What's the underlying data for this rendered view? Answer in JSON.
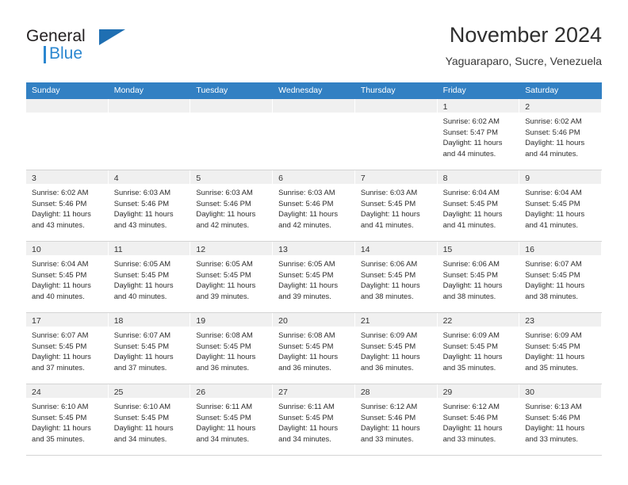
{
  "brand": {
    "name_part1": "General",
    "name_part2": "Blue",
    "triangle_color": "#1f6fb2",
    "blue_color": "#2b87d0"
  },
  "header": {
    "title": "November 2024",
    "subtitle": "Yaguaraparo, Sucre, Venezuela"
  },
  "theme": {
    "header_band": "#3280c3",
    "daynum_strip": "#f0f0f0",
    "grid_line": "#d4d4d4",
    "text": "#2c2c2c"
  },
  "weekdays": [
    "Sunday",
    "Monday",
    "Tuesday",
    "Wednesday",
    "Thursday",
    "Friday",
    "Saturday"
  ],
  "weeks": [
    [
      {
        "day": "",
        "lines": []
      },
      {
        "day": "",
        "lines": []
      },
      {
        "day": "",
        "lines": []
      },
      {
        "day": "",
        "lines": []
      },
      {
        "day": "",
        "lines": []
      },
      {
        "day": "1",
        "lines": [
          "Sunrise: 6:02 AM",
          "Sunset: 5:47 PM",
          "Daylight: 11 hours and 44 minutes."
        ]
      },
      {
        "day": "2",
        "lines": [
          "Sunrise: 6:02 AM",
          "Sunset: 5:46 PM",
          "Daylight: 11 hours and 44 minutes."
        ]
      }
    ],
    [
      {
        "day": "3",
        "lines": [
          "Sunrise: 6:02 AM",
          "Sunset: 5:46 PM",
          "Daylight: 11 hours and 43 minutes."
        ]
      },
      {
        "day": "4",
        "lines": [
          "Sunrise: 6:03 AM",
          "Sunset: 5:46 PM",
          "Daylight: 11 hours and 43 minutes."
        ]
      },
      {
        "day": "5",
        "lines": [
          "Sunrise: 6:03 AM",
          "Sunset: 5:46 PM",
          "Daylight: 11 hours and 42 minutes."
        ]
      },
      {
        "day": "6",
        "lines": [
          "Sunrise: 6:03 AM",
          "Sunset: 5:46 PM",
          "Daylight: 11 hours and 42 minutes."
        ]
      },
      {
        "day": "7",
        "lines": [
          "Sunrise: 6:03 AM",
          "Sunset: 5:45 PM",
          "Daylight: 11 hours and 41 minutes."
        ]
      },
      {
        "day": "8",
        "lines": [
          "Sunrise: 6:04 AM",
          "Sunset: 5:45 PM",
          "Daylight: 11 hours and 41 minutes."
        ]
      },
      {
        "day": "9",
        "lines": [
          "Sunrise: 6:04 AM",
          "Sunset: 5:45 PM",
          "Daylight: 11 hours and 41 minutes."
        ]
      }
    ],
    [
      {
        "day": "10",
        "lines": [
          "Sunrise: 6:04 AM",
          "Sunset: 5:45 PM",
          "Daylight: 11 hours and 40 minutes."
        ]
      },
      {
        "day": "11",
        "lines": [
          "Sunrise: 6:05 AM",
          "Sunset: 5:45 PM",
          "Daylight: 11 hours and 40 minutes."
        ]
      },
      {
        "day": "12",
        "lines": [
          "Sunrise: 6:05 AM",
          "Sunset: 5:45 PM",
          "Daylight: 11 hours and 39 minutes."
        ]
      },
      {
        "day": "13",
        "lines": [
          "Sunrise: 6:05 AM",
          "Sunset: 5:45 PM",
          "Daylight: 11 hours and 39 minutes."
        ]
      },
      {
        "day": "14",
        "lines": [
          "Sunrise: 6:06 AM",
          "Sunset: 5:45 PM",
          "Daylight: 11 hours and 38 minutes."
        ]
      },
      {
        "day": "15",
        "lines": [
          "Sunrise: 6:06 AM",
          "Sunset: 5:45 PM",
          "Daylight: 11 hours and 38 minutes."
        ]
      },
      {
        "day": "16",
        "lines": [
          "Sunrise: 6:07 AM",
          "Sunset: 5:45 PM",
          "Daylight: 11 hours and 38 minutes."
        ]
      }
    ],
    [
      {
        "day": "17",
        "lines": [
          "Sunrise: 6:07 AM",
          "Sunset: 5:45 PM",
          "Daylight: 11 hours and 37 minutes."
        ]
      },
      {
        "day": "18",
        "lines": [
          "Sunrise: 6:07 AM",
          "Sunset: 5:45 PM",
          "Daylight: 11 hours and 37 minutes."
        ]
      },
      {
        "day": "19",
        "lines": [
          "Sunrise: 6:08 AM",
          "Sunset: 5:45 PM",
          "Daylight: 11 hours and 36 minutes."
        ]
      },
      {
        "day": "20",
        "lines": [
          "Sunrise: 6:08 AM",
          "Sunset: 5:45 PM",
          "Daylight: 11 hours and 36 minutes."
        ]
      },
      {
        "day": "21",
        "lines": [
          "Sunrise: 6:09 AM",
          "Sunset: 5:45 PM",
          "Daylight: 11 hours and 36 minutes."
        ]
      },
      {
        "day": "22",
        "lines": [
          "Sunrise: 6:09 AM",
          "Sunset: 5:45 PM",
          "Daylight: 11 hours and 35 minutes."
        ]
      },
      {
        "day": "23",
        "lines": [
          "Sunrise: 6:09 AM",
          "Sunset: 5:45 PM",
          "Daylight: 11 hours and 35 minutes."
        ]
      }
    ],
    [
      {
        "day": "24",
        "lines": [
          "Sunrise: 6:10 AM",
          "Sunset: 5:45 PM",
          "Daylight: 11 hours and 35 minutes."
        ]
      },
      {
        "day": "25",
        "lines": [
          "Sunrise: 6:10 AM",
          "Sunset: 5:45 PM",
          "Daylight: 11 hours and 34 minutes."
        ]
      },
      {
        "day": "26",
        "lines": [
          "Sunrise: 6:11 AM",
          "Sunset: 5:45 PM",
          "Daylight: 11 hours and 34 minutes."
        ]
      },
      {
        "day": "27",
        "lines": [
          "Sunrise: 6:11 AM",
          "Sunset: 5:45 PM",
          "Daylight: 11 hours and 34 minutes."
        ]
      },
      {
        "day": "28",
        "lines": [
          "Sunrise: 6:12 AM",
          "Sunset: 5:46 PM",
          "Daylight: 11 hours and 33 minutes."
        ]
      },
      {
        "day": "29",
        "lines": [
          "Sunrise: 6:12 AM",
          "Sunset: 5:46 PM",
          "Daylight: 11 hours and 33 minutes."
        ]
      },
      {
        "day": "30",
        "lines": [
          "Sunrise: 6:13 AM",
          "Sunset: 5:46 PM",
          "Daylight: 11 hours and 33 minutes."
        ]
      }
    ]
  ]
}
